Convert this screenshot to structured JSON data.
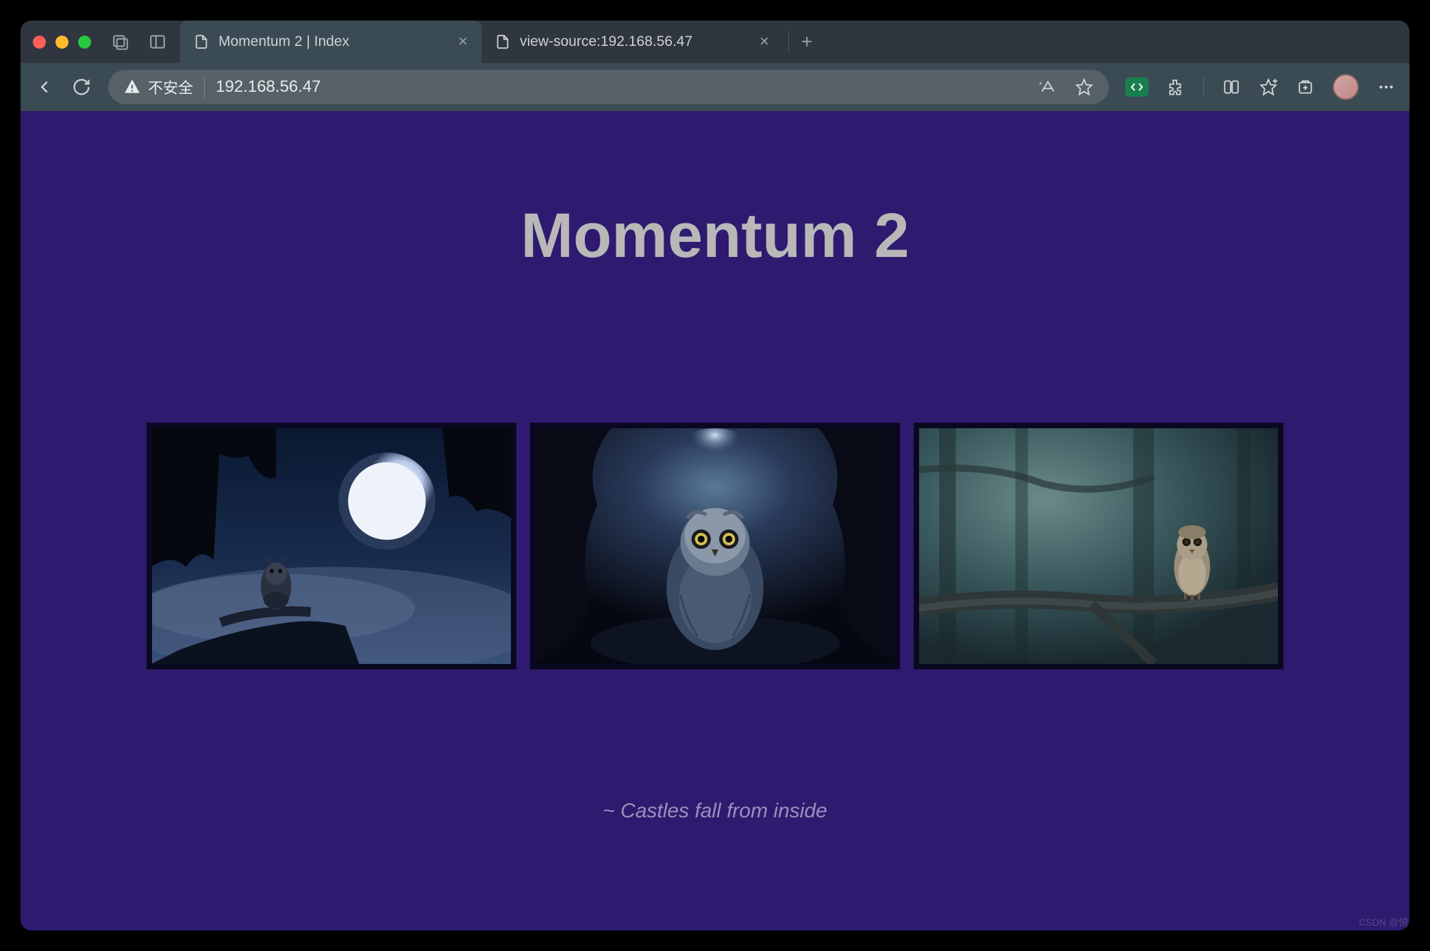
{
  "browser": {
    "tabs": [
      {
        "title": "Momentum 2 | Index",
        "active": true
      },
      {
        "title": "view-source:192.168.56.47",
        "active": false
      }
    ],
    "security_label": "不安全",
    "url": "192.168.56.47"
  },
  "page": {
    "heading": "Momentum 2",
    "tagline": "~ Castles fall from inside",
    "images": [
      {
        "alt": "owl-moon-night"
      },
      {
        "alt": "owl-cave-closeup"
      },
      {
        "alt": "owl-branch-forest"
      }
    ]
  },
  "watermark": "CSDN @悦"
}
